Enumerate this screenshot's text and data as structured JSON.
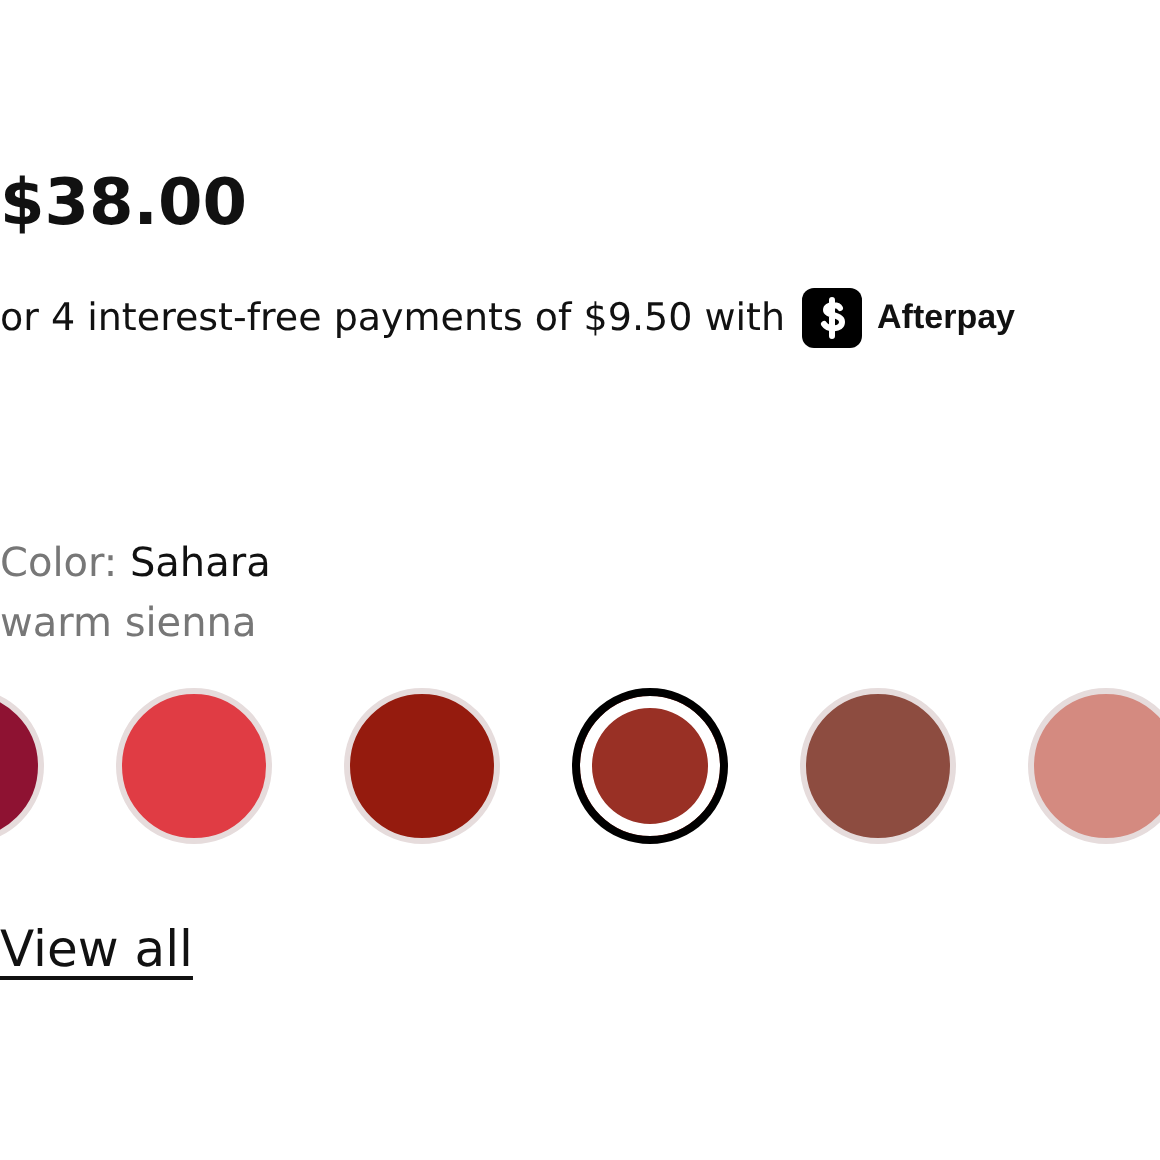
{
  "price": "$38.00",
  "installments": {
    "text": "or 4 interest-free payments of $9.50 with",
    "provider": "Afterpay"
  },
  "color": {
    "label": "Color:",
    "value": "Sahara",
    "description": "warm sienna"
  },
  "swatches": [
    {
      "color": "#8e1232",
      "selected": false
    },
    {
      "color": "#e03c44",
      "selected": false
    },
    {
      "color": "#951b0e",
      "selected": false
    },
    {
      "color": "#993025",
      "selected": true
    },
    {
      "color": "#8d4c40",
      "selected": false
    },
    {
      "color": "#d48a80",
      "selected": false
    }
  ],
  "view_all": "View all"
}
